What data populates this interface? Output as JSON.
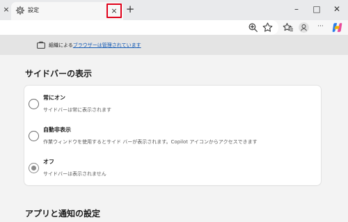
{
  "browser": {
    "tab_title": "設定",
    "tab_close_glyph": "×",
    "left_close_glyph": "×",
    "new_tab_glyph": "+",
    "minimize_glyph": "–",
    "maximize_glyph": "□",
    "close_window_glyph": "✕",
    "more_glyph": "···"
  },
  "banner": {
    "text_prefix": "組織による",
    "link_text": "ブラウザーは管理されています"
  },
  "sidebar_section": {
    "title": "サイドバーの表示",
    "options": [
      {
        "label": "常にオン",
        "description": "サイドバーは常に表示されます",
        "selected": false
      },
      {
        "label": "自動非表示",
        "description": "作業ウィンドウを使用するとサイド バーが表示されます。Copilot アイコンからアクセスできます",
        "selected": false
      },
      {
        "label": "オフ",
        "description": "サイドバーは表示されません",
        "selected": true
      }
    ]
  },
  "next_section": {
    "title": "アプリと通知の設定"
  },
  "colors": {
    "highlight_box": "#e0001a",
    "link": "#0f57b4",
    "radio_selected": "#8a8a8a"
  }
}
